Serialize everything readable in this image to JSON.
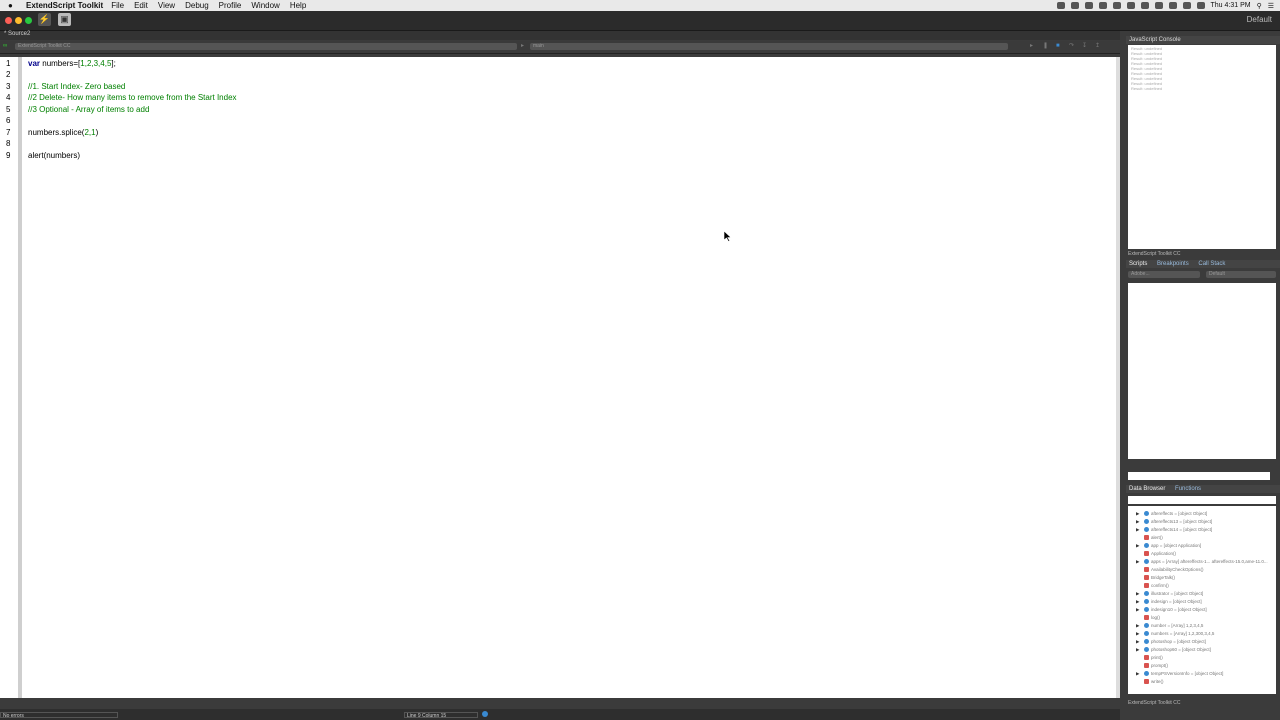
{
  "menubar": {
    "app_name": "ExtendScript Toolkit",
    "menus": [
      "File",
      "Edit",
      "View",
      "Debug",
      "Profile",
      "Window",
      "Help"
    ],
    "clock": "Thu 4:31 PM"
  },
  "toolbar": {
    "workspace": "Default"
  },
  "document": {
    "tab_label": "* Source2"
  },
  "targets": {
    "application": "ExtendScript Toolkit CC",
    "engine": "main"
  },
  "editor": {
    "line_numbers": [
      "1",
      "2",
      "3",
      "4",
      "5",
      "6",
      "7",
      "8",
      "9"
    ],
    "line1_kw": "var",
    "line1_rest": " numbers=[",
    "line1_nums": "1,2,3,4,5",
    "line1_end": "];",
    "line3": "//1. Start Index- Zero based",
    "line4": "//2 Delete- How many items to remove from the Start Index",
    "line5": "//3 Optional - Array of items to add",
    "line7_a": "numbers.splice(",
    "line7_nums": "2,1",
    "line7_b": ")",
    "line9": "alert(numbers)"
  },
  "status": {
    "errors": "No errors",
    "position": "Line 9    Column 15"
  },
  "console": {
    "title": "JavaScript Console",
    "lines": [
      "Result: undefined",
      "Result: undefined",
      "Result: undefined",
      "Result: undefined",
      "Result: undefined",
      "Result: undefined",
      "Result: undefined",
      "Result: undefined",
      "Result: undefined"
    ],
    "footer": "ExtendScript Toolkit CC"
  },
  "scripts_panel": {
    "tabs": [
      "Scripts",
      "Breakpoints",
      "Call Stack"
    ],
    "select1": "Adobe...",
    "select2": "Default"
  },
  "data_browser": {
    "tabs": [
      "Data Browser",
      "Functions"
    ],
    "rows": [
      {
        "text": "aftereffects = [object Object]",
        "type": "obj",
        "expand": true
      },
      {
        "text": "aftereffects13 = [object Object]",
        "type": "obj",
        "expand": true
      },
      {
        "text": "aftereffects14 = [object Object]",
        "type": "obj",
        "expand": true
      },
      {
        "text": "alert()",
        "type": "fn",
        "expand": false
      },
      {
        "text": "app = [object Application]",
        "type": "obj",
        "expand": true
      },
      {
        "text": "Application()",
        "type": "fn",
        "expand": false
      },
      {
        "text": "apps = [Array] aftereffects-1... aftereffects-15.0,ame-11.0...",
        "type": "obj",
        "expand": true
      },
      {
        "text": "AvailabilityCheckOptions()",
        "type": "fn",
        "expand": false
      },
      {
        "text": "BridgeTalk()",
        "type": "fn",
        "expand": false
      },
      {
        "text": "confirm()",
        "type": "fn",
        "expand": false
      },
      {
        "text": "illustrator = [object Object]",
        "type": "obj",
        "expand": true
      },
      {
        "text": "indesign = [object Object]",
        "type": "obj",
        "expand": true
      },
      {
        "text": "indesign10 = [object Object]",
        "type": "obj",
        "expand": true
      },
      {
        "text": "log()",
        "type": "fn",
        "expand": false
      },
      {
        "text": "number = [Array] 1,2,3,4,5",
        "type": "obj",
        "expand": true
      },
      {
        "text": "numbers = [Array] 1,2,300,3,4,5",
        "type": "obj",
        "expand": true
      },
      {
        "text": "photoshop = [object Object]",
        "type": "obj",
        "expand": true
      },
      {
        "text": "photoshop60 = [object Object]",
        "type": "obj",
        "expand": true
      },
      {
        "text": "print()",
        "type": "fn",
        "expand": false
      },
      {
        "text": "prompt()",
        "type": "fn",
        "expand": false
      },
      {
        "text": "tempPSVersionInfo = [object Object]",
        "type": "obj",
        "expand": true
      },
      {
        "text": "write()",
        "type": "fn",
        "expand": false
      }
    ],
    "footer": "ExtendScript Toolkit CC"
  }
}
